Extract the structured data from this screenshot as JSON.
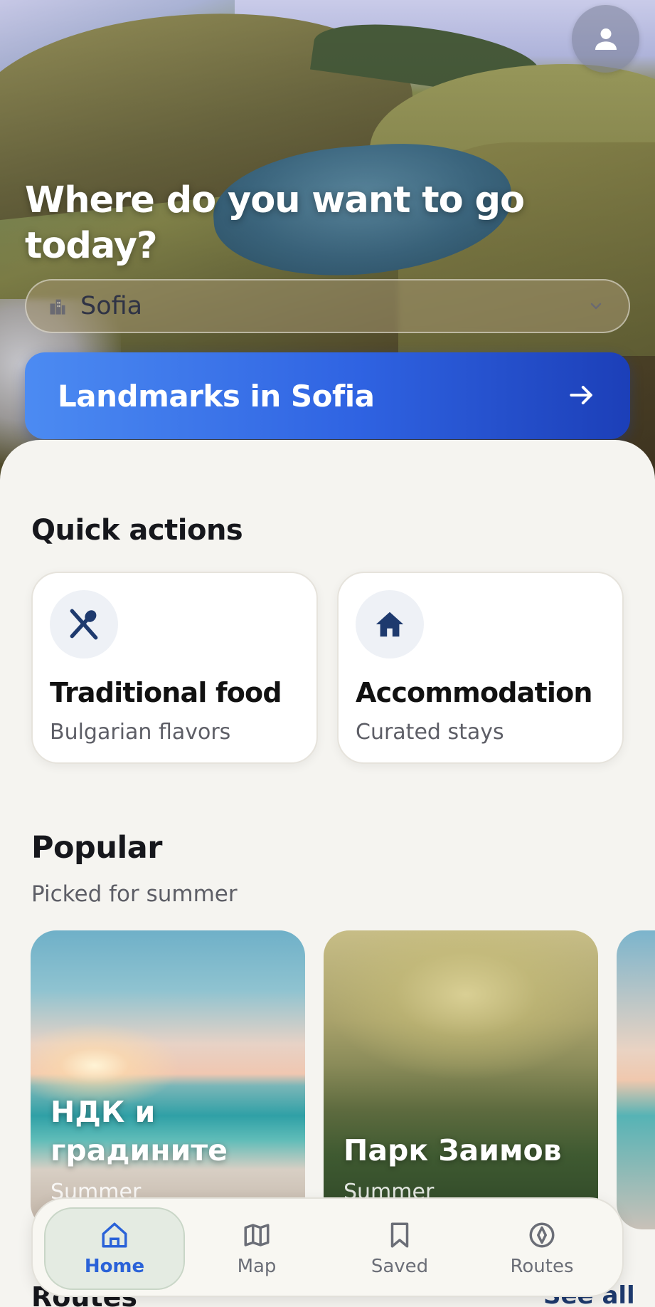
{
  "header": {
    "title": "Where do you want to go today?",
    "profile_icon": "user-icon"
  },
  "city_select": {
    "value": "Sofia",
    "icon": "city-icon"
  },
  "primary_cta": {
    "label": "Landmarks in Sofia",
    "icon": "arrow-right-icon"
  },
  "quick_actions": {
    "title": "Quick actions",
    "items": [
      {
        "title": "Traditional food",
        "subtitle": "Bulgarian flavors",
        "icon": "utensils-icon"
      },
      {
        "title": "Accommodation",
        "subtitle": "Curated stays",
        "icon": "house-icon"
      }
    ]
  },
  "popular": {
    "title": "Popular",
    "subtitle": "Picked for summer",
    "items": [
      {
        "name": "НДК и градините",
        "season": "Summer"
      },
      {
        "name": "Парк Заимов",
        "season": "Summer"
      }
    ]
  },
  "routes": {
    "title": "Routes",
    "see_all": "See all"
  },
  "bottom_nav": {
    "active": "Home",
    "items": [
      {
        "label": "Home",
        "icon": "home-icon"
      },
      {
        "label": "Map",
        "icon": "map-icon"
      },
      {
        "label": "Saved",
        "icon": "bookmark-icon"
      },
      {
        "label": "Routes",
        "icon": "compass-icon"
      }
    ]
  },
  "colors": {
    "accent": "#2a62d8",
    "cta_start": "#4c8bf2",
    "cta_end": "#1c3fb8",
    "background": "#f5f4f0",
    "icon_dark": "#1e3a6e"
  }
}
